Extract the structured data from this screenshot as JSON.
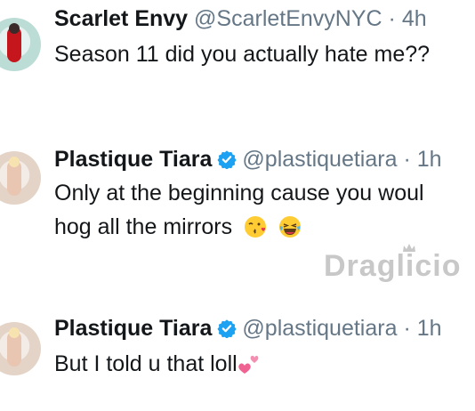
{
  "tweets": [
    {
      "name": "Scarlet Envy",
      "handle": "@ScarletEnvyNYC",
      "time": "4h",
      "lines": [
        "Season 11 did you actually hate me??"
      ]
    },
    {
      "name": "Plastique Tiara",
      "handle": "@plastiquetiara",
      "time": "1h",
      "lines": [
        "Only at the beginning cause you woul",
        "hog all the mirrors"
      ],
      "emojis": [
        "kiss-face-emoji",
        "laughing-tears-emoji"
      ]
    },
    {
      "name": "Plastique Tiara",
      "handle": "@plastiquetiara",
      "time": "1h",
      "lines": [
        "But I told u that loll"
      ],
      "emojis": [
        "two-hearts-emoji"
      ]
    }
  ],
  "watermark": "Draglicio",
  "colors": {
    "text": "#14171a",
    "muted": "#657786",
    "verified": "#1da1f2"
  }
}
